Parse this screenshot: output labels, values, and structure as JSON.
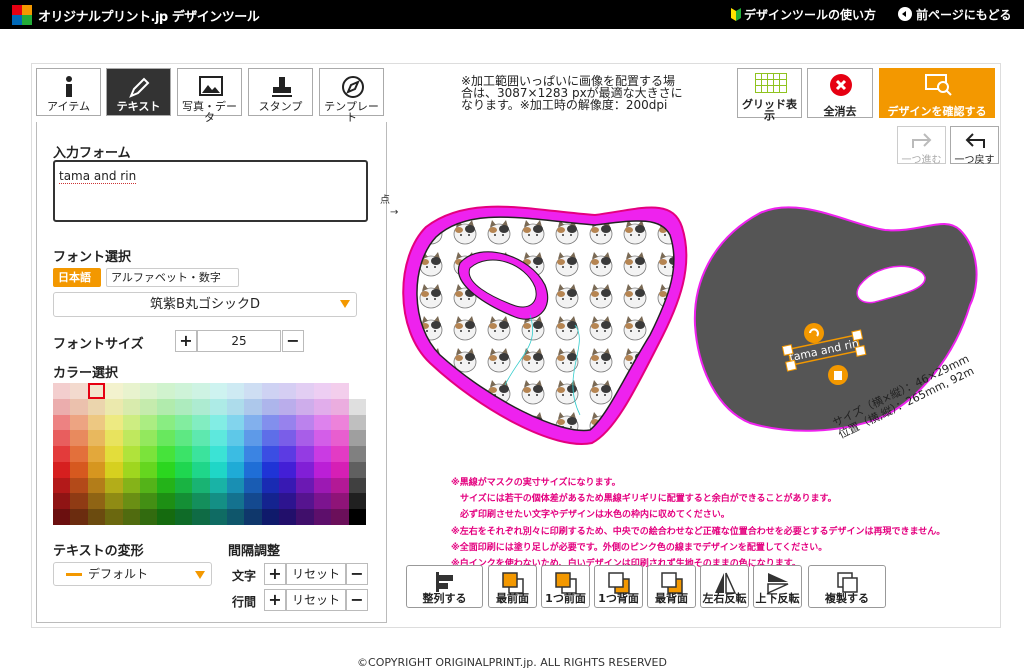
{
  "header": {
    "brand": "オリジナルプリント.jp デザインツール",
    "howto": "デザインツールの使い方",
    "back": "前ページにもどる"
  },
  "tabs": [
    {
      "label": "アイテム",
      "icon": "info-icon"
    },
    {
      "label": "テキスト",
      "icon": "pen-icon"
    },
    {
      "label": "写真・データ",
      "icon": "image-icon"
    },
    {
      "label": "スタンプ",
      "icon": "stamp-icon"
    },
    {
      "label": "テンプレート",
      "icon": "template-icon"
    }
  ],
  "panel": {
    "input_label": "入力フォーム",
    "input_value": "tama and rin",
    "font_label": "フォント選択",
    "font_jp": "日本語",
    "font_alpha": "アルファベット・数字",
    "font_selected": "筑紫B丸ゴシックD",
    "size_label": "フォントサイズ",
    "size_value": "25",
    "plus": "+",
    "minus": "−",
    "color_label": "カラー選択",
    "transform_label": "テキストの変形",
    "transform_value": "デフォルト",
    "spacing_label": "間隔調整",
    "char_label": "文字",
    "line_label": "行間",
    "reset": "リセット"
  },
  "note": "※加工範囲いっぱいに画像を配置する場合は、3087×1283 pxが最適な大きさになります。※加工時の解像度：200dpi",
  "toolbar": {
    "grid": "グリッド表示",
    "clear": "全消去",
    "confirm": "デザインを確認する",
    "redo": "一つ進む",
    "undo": "一つ戻す"
  },
  "canvas": {
    "start_label": "点",
    "selected_text": "tama and rin",
    "size_info": "サイズ（横×縦）：46×29mm",
    "pos_info": "位置（横,縦）：265mm, 92m"
  },
  "warnings": [
    "※黒線がマスクの実寸サイズになります。",
    "　サイズには若干の個体差があるため黒線ギリギリに配置すると余白ができることがあります。",
    "　必ず印刷させたい文字やデザインは水色の枠内に収めてください。",
    "※左右をそれぞれ別々に印刷するため、中央での絵合わせなど正確な位置合わせを必要とするデザインは再現できません。",
    "※全面印刷には塗り足しが必要です。外側のピンク色の線までデザインを配置してください。",
    "※白インクを使わないため、白いデザインは印刷されず生地そのままの色になります。"
  ],
  "bottom": [
    "整列する",
    "最前面",
    "1つ前面",
    "1つ背面",
    "最背面",
    "左右反転",
    "上下反転",
    "複製する"
  ],
  "footer": "©COPYRIGHT ORIGINALPRINT.jp. ALL RIGHTS RESERVED",
  "colors": {
    "accent": "#f39800",
    "magenta": "#e4007f",
    "mask_right": "#555555"
  }
}
